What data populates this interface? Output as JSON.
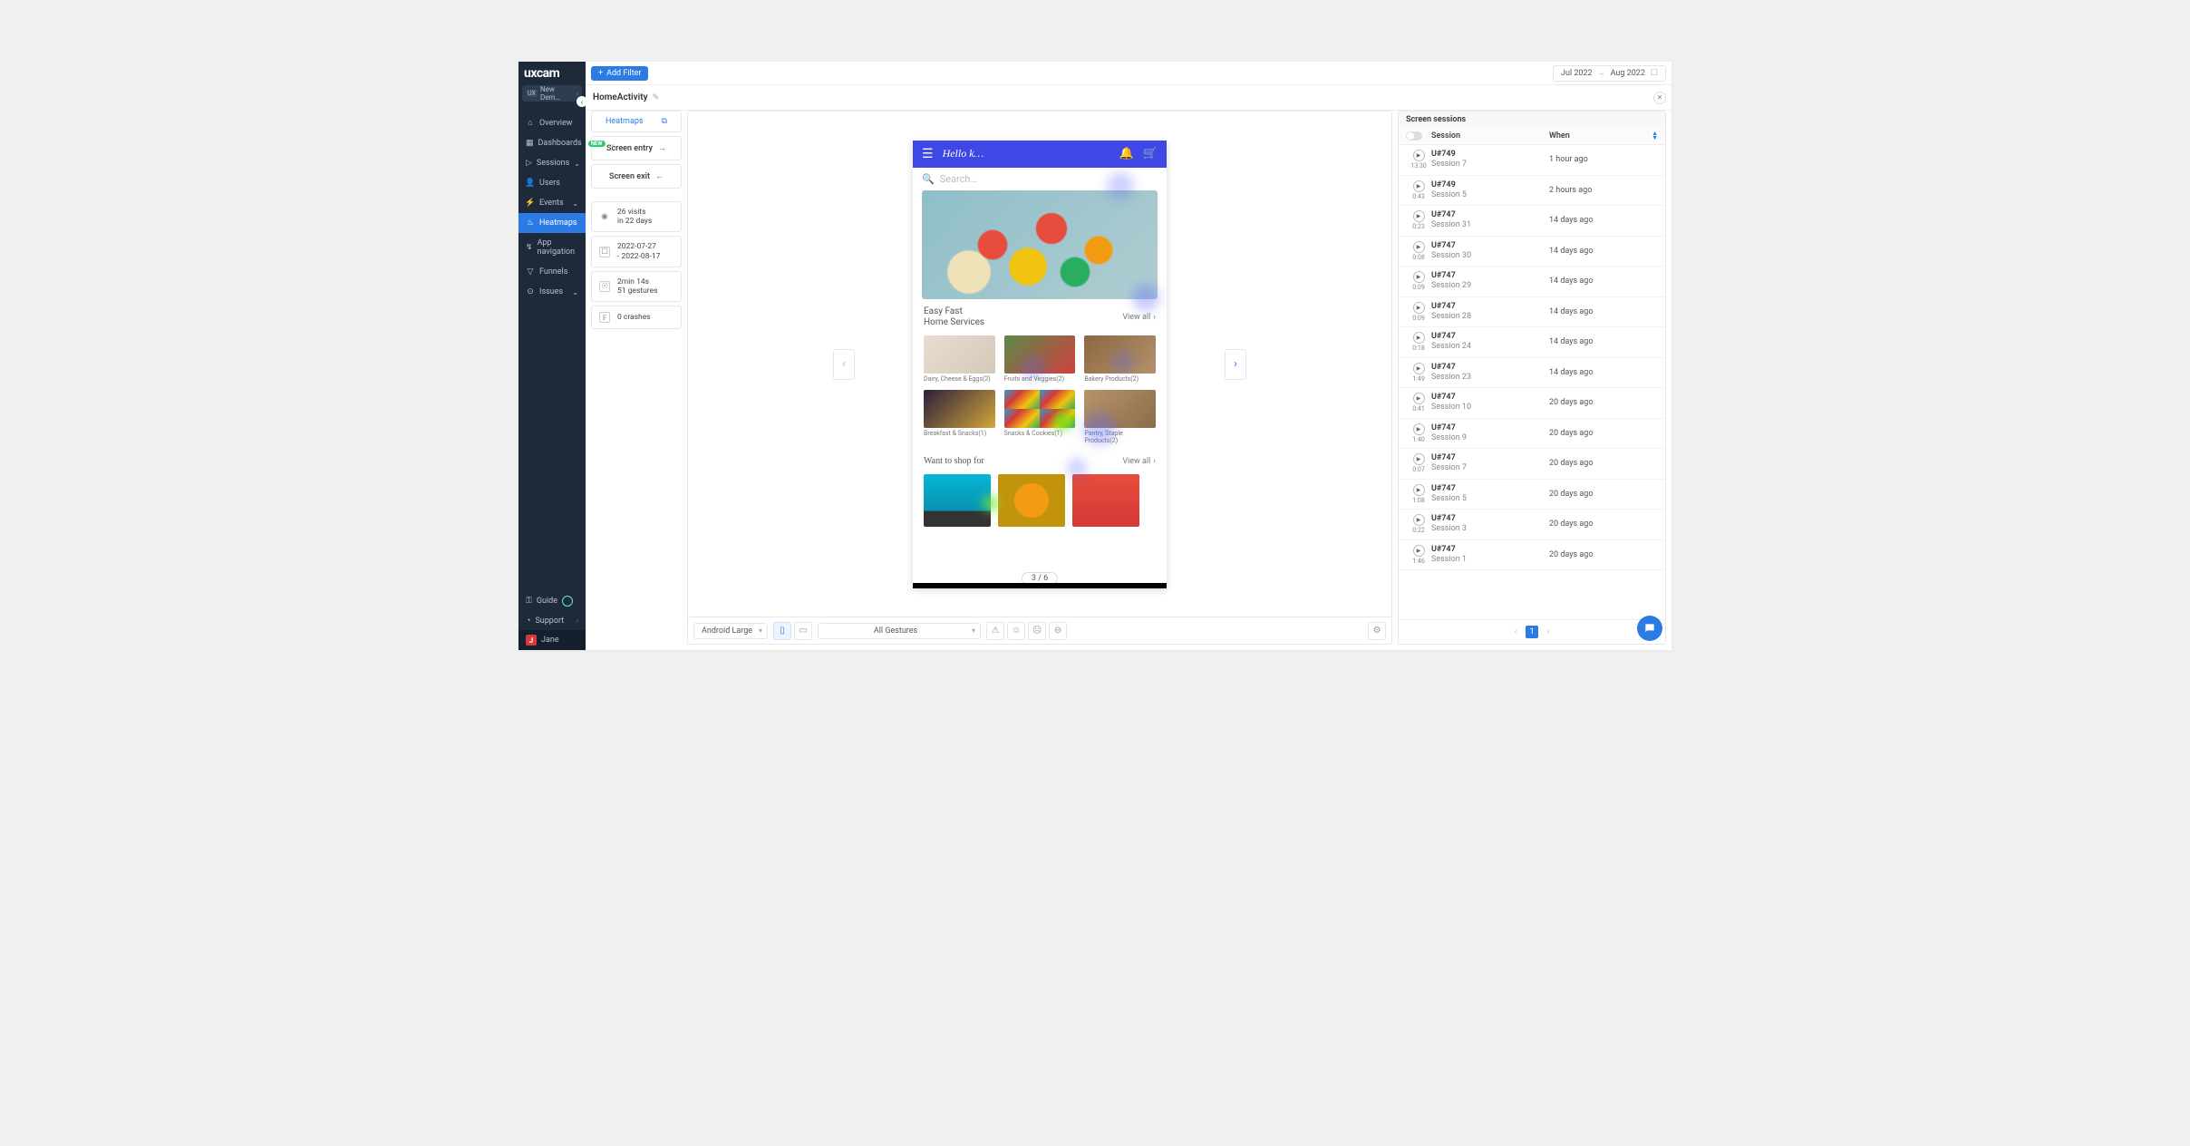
{
  "brand": "uxcam",
  "app_selector": {
    "prefix": "UX",
    "label": "New Dem…"
  },
  "nav": [
    {
      "label": "Overview",
      "icon": "home"
    },
    {
      "label": "Dashboards",
      "icon": "grid",
      "badge": "NEW",
      "chev": true
    },
    {
      "label": "Sessions",
      "icon": "play",
      "chev": true
    },
    {
      "label": "Users",
      "icon": "user"
    },
    {
      "label": "Events",
      "icon": "bolt",
      "chev": true
    },
    {
      "label": "Heatmaps",
      "icon": "fire",
      "active": true
    },
    {
      "label": "App navigation",
      "icon": "route"
    },
    {
      "label": "Funnels",
      "icon": "funnel"
    },
    {
      "label": "Issues",
      "icon": "alert",
      "chev": true
    }
  ],
  "sidebar_bottom": {
    "guide": "Guide",
    "support": "Support",
    "user": "Jane",
    "user_initial": "J"
  },
  "topbar": {
    "add_filter": "Add Filter",
    "date_from": "Jul 2022",
    "date_to": "Aug 2022"
  },
  "page_title": "HomeActivity",
  "left": {
    "tab": "Heatmaps",
    "entry": "Screen entry",
    "exit": "Screen exit",
    "visits_l1": "26 visits",
    "visits_l2": "in 22 days",
    "range_l1": "2022-07-27",
    "range_l2": "- 2022-08-17",
    "gest_l1": "2min 14s",
    "gest_l2": "51 gestures",
    "crashes": "0 crashes"
  },
  "phone": {
    "greeting": "Hello k…",
    "search_placeholder": "Search…",
    "section1_l1": "Easy Fast",
    "section1_l2": "Home Services",
    "viewall": "View all",
    "cats": [
      "Dairy, Cheese & Eggs(2)",
      "Fruits and Veggies(2)",
      "Bakery Products(2)",
      "Breakfast & Snacks(1)",
      "Snacks & Cookies(1)",
      "Pantry, Staple Products(2)"
    ],
    "section2": "Want to shop for",
    "page_indicator": "3 / 6"
  },
  "toolbar": {
    "device": "Android Large",
    "gestures": "All Gestures"
  },
  "sessions": {
    "title": "Screen sessions",
    "col_session": "Session",
    "col_when": "When",
    "rows": [
      {
        "dur": "13:30",
        "user": "U#749",
        "name": "Session 7",
        "when": "1 hour ago"
      },
      {
        "dur": "0:43",
        "user": "U#749",
        "name": "Session 5",
        "when": "2 hours ago"
      },
      {
        "dur": "0:23",
        "user": "U#747",
        "name": "Session 31",
        "when": "14 days ago"
      },
      {
        "dur": "0:08",
        "user": "U#747",
        "name": "Session 30",
        "when": "14 days ago"
      },
      {
        "dur": "0:09",
        "user": "U#747",
        "name": "Session 29",
        "when": "14 days ago"
      },
      {
        "dur": "0:09",
        "user": "U#747",
        "name": "Session 28",
        "when": "14 days ago"
      },
      {
        "dur": "0:18",
        "user": "U#747",
        "name": "Session 24",
        "when": "14 days ago"
      },
      {
        "dur": "1:49",
        "user": "U#747",
        "name": "Session 23",
        "when": "14 days ago"
      },
      {
        "dur": "0:41",
        "user": "U#747",
        "name": "Session 10",
        "when": "20 days ago"
      },
      {
        "dur": "1:40",
        "user": "U#747",
        "name": "Session 9",
        "when": "20 days ago"
      },
      {
        "dur": "0:07",
        "user": "U#747",
        "name": "Session 7",
        "when": "20 days ago"
      },
      {
        "dur": "1:08",
        "user": "U#747",
        "name": "Session 5",
        "when": "20 days ago"
      },
      {
        "dur": "0:22",
        "user": "U#747",
        "name": "Session 3",
        "when": "20 days ago"
      },
      {
        "dur": "1:46",
        "user": "U#747",
        "name": "Session 1",
        "when": "20 days ago"
      }
    ],
    "page": "1"
  }
}
